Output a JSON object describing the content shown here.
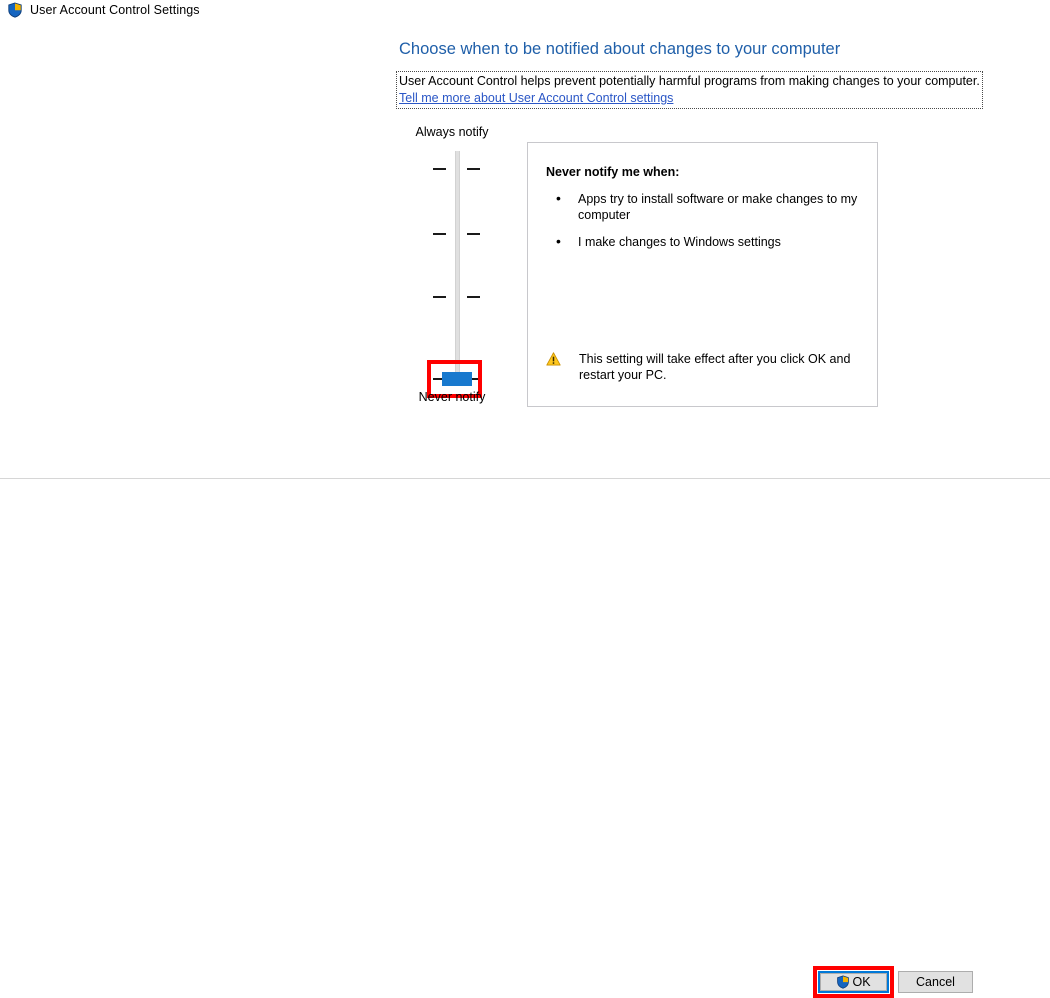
{
  "window": {
    "title": "User Account Control Settings",
    "title_icon": "shield-icon"
  },
  "main": {
    "heading": "Choose when to be notified about changes to your computer",
    "description": "User Account Control helps prevent potentially harmful programs from making changes to your computer.",
    "link_text": "Tell me more about User Account Control settings"
  },
  "slider": {
    "top_label": "Always notify",
    "bottom_label": "Never notify",
    "levels": 4,
    "selected_level": 1,
    "selected_level_name": "Never notify",
    "thumb_color": "#1879CE",
    "highlight_color": "#FF0000"
  },
  "info_panel": {
    "title": "Never notify me when:",
    "bullets": [
      "Apps try to install software or make changes to my computer",
      "I make changes to Windows settings"
    ],
    "warning": {
      "icon": "warning-triangle-icon",
      "text": "This setting will take effect after you click OK and restart your PC."
    }
  },
  "footer": {
    "ok_label": "OK",
    "ok_icon": "shield-icon",
    "cancel_label": "Cancel",
    "focus_color": "#0078D7",
    "highlight_color": "#FF0000"
  }
}
